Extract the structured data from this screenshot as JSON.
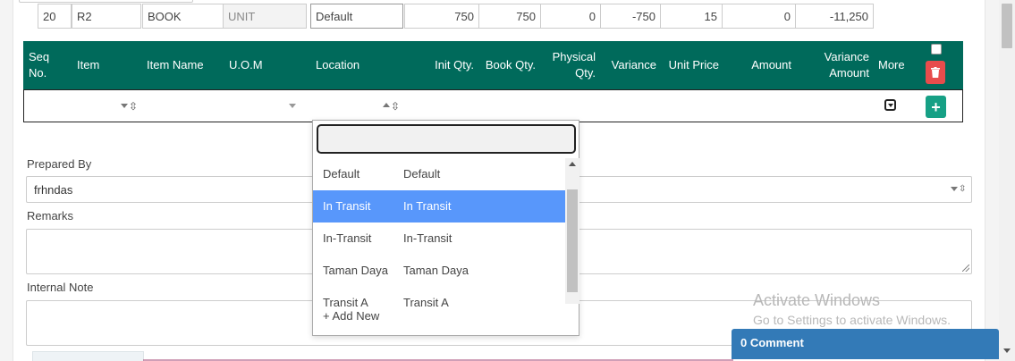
{
  "table": {
    "headers": {
      "seq": "Seq No.",
      "item": "Item",
      "item_name": "Item Name",
      "uom": "U.O.M",
      "location": "Location",
      "init_qty": "Init Qty.",
      "book_qty": "Book Qty.",
      "physical_qty": "Physical Qty.",
      "variance": "Variance",
      "unit_price": "Unit Price",
      "amount": "Amount",
      "variance_amount": "Variance Amount",
      "more": "More"
    },
    "row": {
      "seq": "20",
      "item": "R2",
      "item_name": "BOOK",
      "uom": "UNIT",
      "location": "Default",
      "init_qty": "750",
      "book_qty": "750",
      "physical_qty": "0",
      "variance": "-750",
      "unit_price": "15",
      "amount": "0",
      "variance_amount": "-11,250"
    },
    "add_symbol": "+"
  },
  "form": {
    "prepared_by_label": "Prepared By",
    "prepared_by_value": "frhndas",
    "remarks_label": "Remarks",
    "internal_note_label": "Internal Note"
  },
  "location_dropdown": {
    "search_value": "",
    "items": [
      {
        "code": "Default",
        "name": "Default",
        "selected": false
      },
      {
        "code": "In Transit",
        "name": "In Transit",
        "selected": true
      },
      {
        "code": "In-Transit",
        "name": "In-Transit",
        "selected": false
      },
      {
        "code": "Taman Daya",
        "name": "Taman Daya",
        "selected": false
      },
      {
        "code": "Transit A",
        "name": "Transit A",
        "selected": false
      }
    ],
    "add_new": "+ Add New"
  },
  "watermark": {
    "line1": "Activate Windows",
    "line2": "Go to Settings to activate Windows."
  },
  "comment": {
    "label": "0 Comment"
  },
  "colors": {
    "header_bg": "#006a5b",
    "delete": "#e74c4c",
    "add": "#16a085",
    "selected": "#5897fb",
    "comment_bar": "#337ab7"
  }
}
